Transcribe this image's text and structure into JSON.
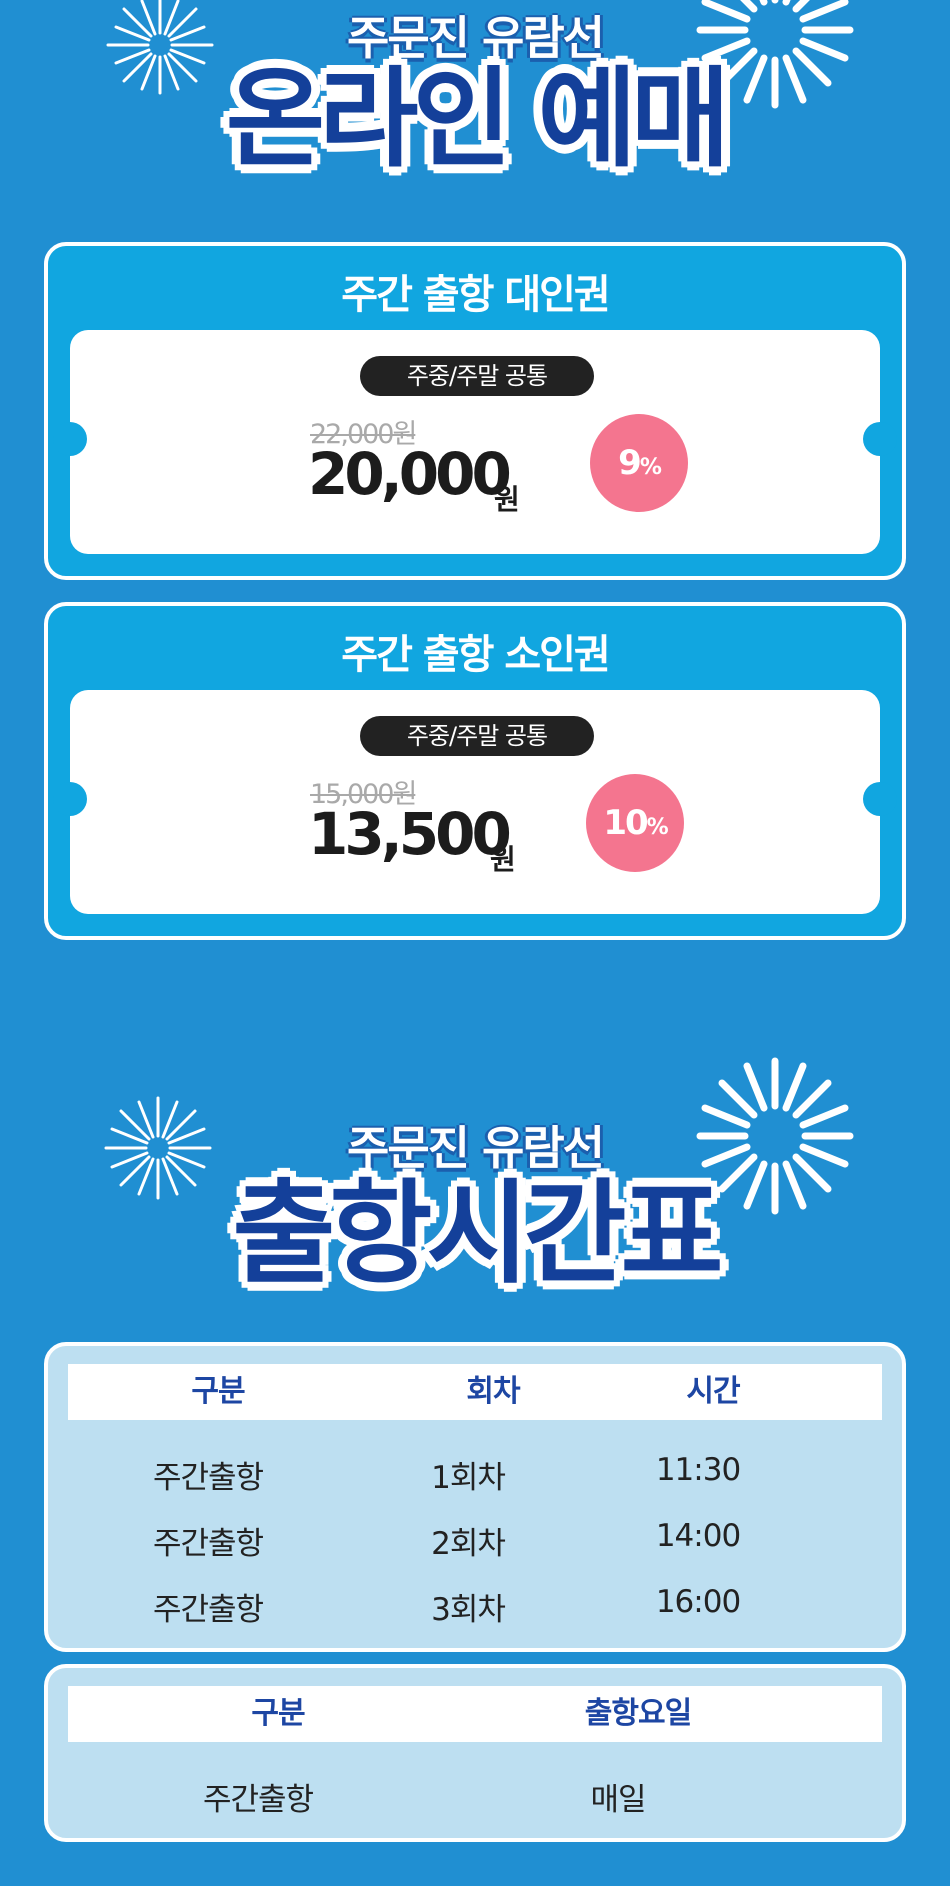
{
  "online_header": {
    "subtitle": "주문진 유람선",
    "title": "온라인 예매"
  },
  "tickets": [
    {
      "title": "주간 출항 대인권",
      "tag": "주중/주말 공통",
      "original_price": "22,000원",
      "price": "20,000",
      "currency": "원",
      "discount": "9",
      "discount_unit": "%"
    },
    {
      "title": "주간 출항 소인권",
      "tag": "주중/주말 공통",
      "original_price": "15,000원",
      "price": "13,500",
      "currency": "원",
      "discount": "10",
      "discount_unit": "%"
    }
  ],
  "schedule_header": {
    "subtitle": "주문진 유람선",
    "title": "출항시간표"
  },
  "schedule_table": {
    "headers": [
      "구분",
      "회차",
      "시간"
    ],
    "rows": [
      [
        "주간출항",
        "1회차",
        "11:30"
      ],
      [
        "주간출항",
        "2회차",
        "14:00"
      ],
      [
        "주간출항",
        "3회차",
        "16:00"
      ]
    ]
  },
  "days_table": {
    "headers": [
      "구분",
      "출항요일"
    ],
    "rows": [
      [
        "주간출항",
        "매일"
      ]
    ]
  },
  "colors": {
    "background": "#208fd2",
    "ticket": "#11a6e0",
    "title_navy": "#14409a",
    "discount_pink": "#f4758f",
    "table_panel": "#bddff1"
  },
  "icons": [
    "firework-icon"
  ]
}
